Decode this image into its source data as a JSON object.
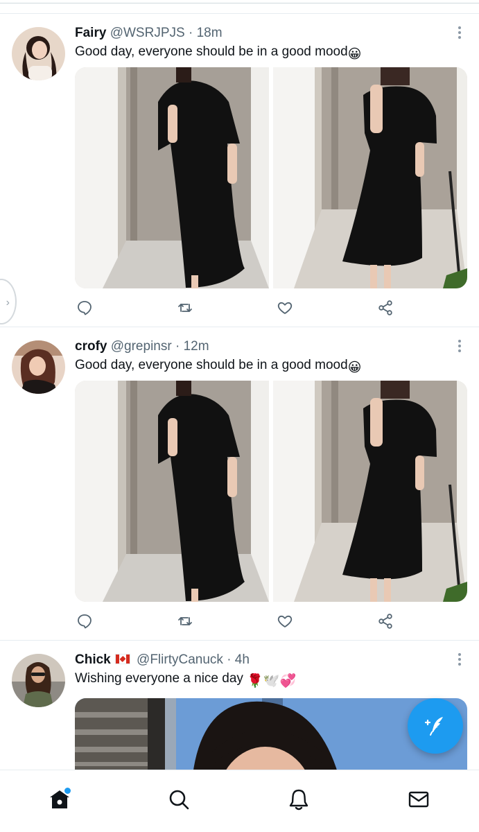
{
  "feed": {
    "tweets": [
      {
        "name": "Fairy",
        "handle": "@WSRJPJS",
        "separator": "·",
        "time": "18m",
        "text": "Good day, everyone should be in a good mood",
        "emoji": "😀",
        "media": [
          "dress-photo-front",
          "dress-photo-side"
        ]
      },
      {
        "name": "crofy",
        "handle": "@grepinsr",
        "separator": "·",
        "time": "12m",
        "text": "Good day, everyone should be in a good mood",
        "emoji": "😀",
        "media": [
          "dress-photo-front",
          "dress-photo-side"
        ]
      },
      {
        "name": "Chick",
        "flag": "canada-flag",
        "handle": "@FlirtyCanuck",
        "separator": "·",
        "time": "4h",
        "text": "Wishing everyone a nice day",
        "emoji": "🌹🕊️💞",
        "media": [
          "portrait-photo"
        ]
      }
    ]
  },
  "icons": {
    "reply": "reply-icon",
    "retweet": "retweet-icon",
    "like": "heart-icon",
    "share": "share-icon",
    "more": "more-vertical-icon",
    "compose": "compose-tweet-icon"
  },
  "bottom_nav": {
    "items": [
      {
        "name": "home",
        "icon": "home-icon",
        "active": true,
        "badge": true
      },
      {
        "name": "search",
        "icon": "search-icon",
        "active": false
      },
      {
        "name": "notifications",
        "icon": "bell-icon",
        "active": false
      },
      {
        "name": "messages",
        "icon": "mail-icon",
        "active": false
      }
    ]
  },
  "colors": {
    "accent": "#1d9bf0",
    "text_primary": "#0f1419",
    "text_secondary": "#536471",
    "divider": "#e6ecf0"
  }
}
